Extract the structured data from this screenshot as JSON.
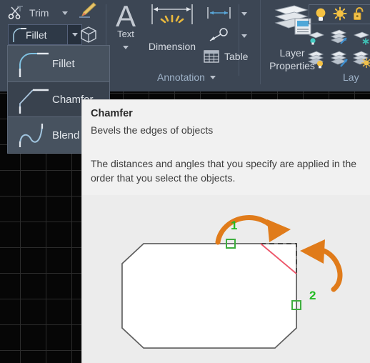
{
  "ribbon": {
    "modify_panel": {
      "trim_label": "Trim",
      "trim_icon": "scissors-icon",
      "trim_caret_icon": "chevron-down-icon",
      "fillet_label": "Fillet",
      "fillet_icon": "fillet-curve-icon",
      "fillet_caret_icon": "chevron-down-icon",
      "pencil_icon": "pencil-icon",
      "box_icon": "3d-box-icon"
    },
    "annotation_panel": {
      "title": "Annotation",
      "title_caret_icon": "chevron-down-icon",
      "text_label": "Text",
      "text_icon": "letter-a-icon",
      "text_caret_icon": "chevron-down-icon",
      "dimension_label": "Dimension",
      "dimension_icon": "dimension-burst-icon",
      "linear_dim_icon": "linear-dimension-icon",
      "linear_dim_caret_icon": "chevron-down-icon",
      "leader_icon": "leader-line-icon",
      "leader_caret_icon": "chevron-down-icon",
      "table_label": "Table",
      "table_icon": "table-grid-icon"
    },
    "layer_panel": {
      "title": "Lay",
      "layer_properties_line1": "Layer",
      "layer_properties_line2": "Properties",
      "layer_properties_icon": "layer-properties-icon",
      "toggles": [
        {
          "name": "lightbulb-on-icon"
        },
        {
          "name": "sun-freeze-icon"
        },
        {
          "name": "unlock-padlock-icon"
        }
      ],
      "layer_tools": [
        {
          "name": "layer-isolate-icon"
        },
        {
          "name": "layer-unisolate-icon"
        },
        {
          "name": "layer-freeze-icon"
        },
        {
          "name": "layer-off-icon"
        },
        {
          "name": "layer-turn-on-icon"
        },
        {
          "name": "layer-thaw-icon"
        }
      ]
    }
  },
  "flyout": {
    "items": [
      {
        "label": "Fillet",
        "icon": "fillet-curve-icon",
        "highlighted": false
      },
      {
        "label": "Chamfer",
        "icon": "chamfer-bevel-icon",
        "highlighted": true
      },
      {
        "label": "Blend C",
        "icon": "blend-curve-icon",
        "highlighted": false
      }
    ]
  },
  "tooltip": {
    "title": "Chamfer",
    "subtitle": "Bevels the edges of objects",
    "body": "The distances and angles that you specify are applied in the order that you select the objects.",
    "diagram": {
      "marker_1": "1",
      "marker_2": "2",
      "shape_outline_color": "#666666",
      "shape_fill_color": "#ffffff",
      "chamfer_line_color": "#f2566a",
      "arrow_color": "#e07b1a",
      "marker_color": "#22bb22",
      "selection_square_color": "#3fae3f"
    }
  },
  "colors": {
    "ribbon_bg": "#3c4654",
    "canvas_bg": "#060606",
    "grid_line": "#2c2c2c",
    "tooltip_bg": "#f1f1f1",
    "accent_orange": "#e07b1a",
    "accent_green": "#22bb22"
  }
}
